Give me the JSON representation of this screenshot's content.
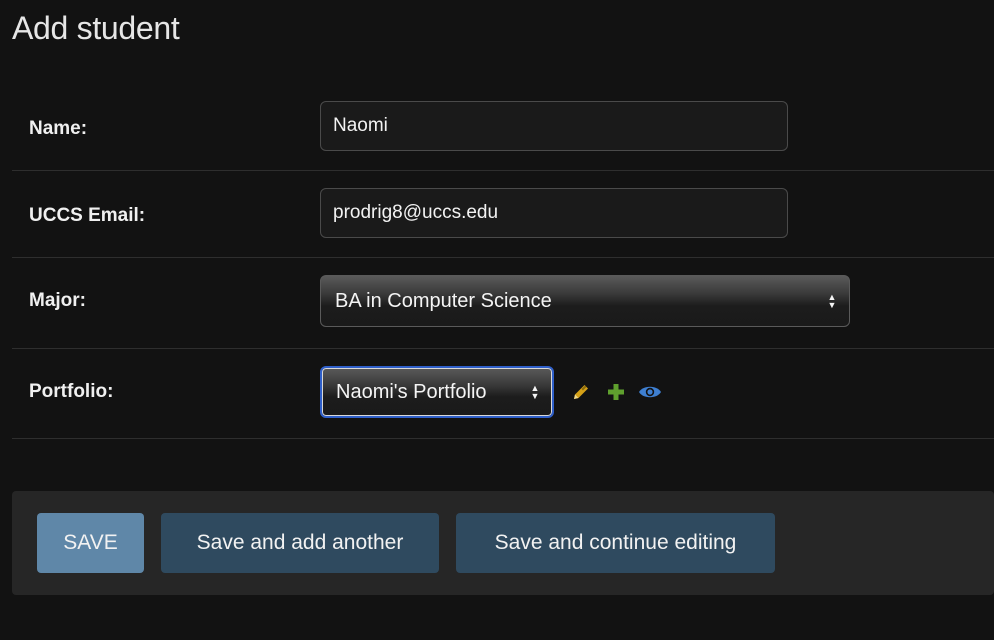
{
  "page": {
    "title": "Add student"
  },
  "form": {
    "name": {
      "label": "Name:",
      "value": "Naomi"
    },
    "email": {
      "label": "UCCS Email:",
      "value": "prodrig8@uccs.edu"
    },
    "major": {
      "label": "Major:",
      "selected": "BA in Computer Science"
    },
    "portfolio": {
      "label": "Portfolio:",
      "selected": "Naomi's Portfolio",
      "actions": {
        "change_icon": "pencil-icon",
        "add_icon": "plus-icon",
        "view_icon": "eye-icon"
      }
    }
  },
  "submit": {
    "save_label": "SAVE",
    "save_add_label": "Save and add another",
    "save_continue_label": "Save and continue editing"
  },
  "colors": {
    "page_bg": "#121212",
    "save_button": "#5f87a8",
    "secondary_button": "#2f4a5f",
    "pencil": "#d4a017",
    "plus": "#5fa02e",
    "eye": "#3e7fd1",
    "focus_ring": "#2f5fc9"
  }
}
